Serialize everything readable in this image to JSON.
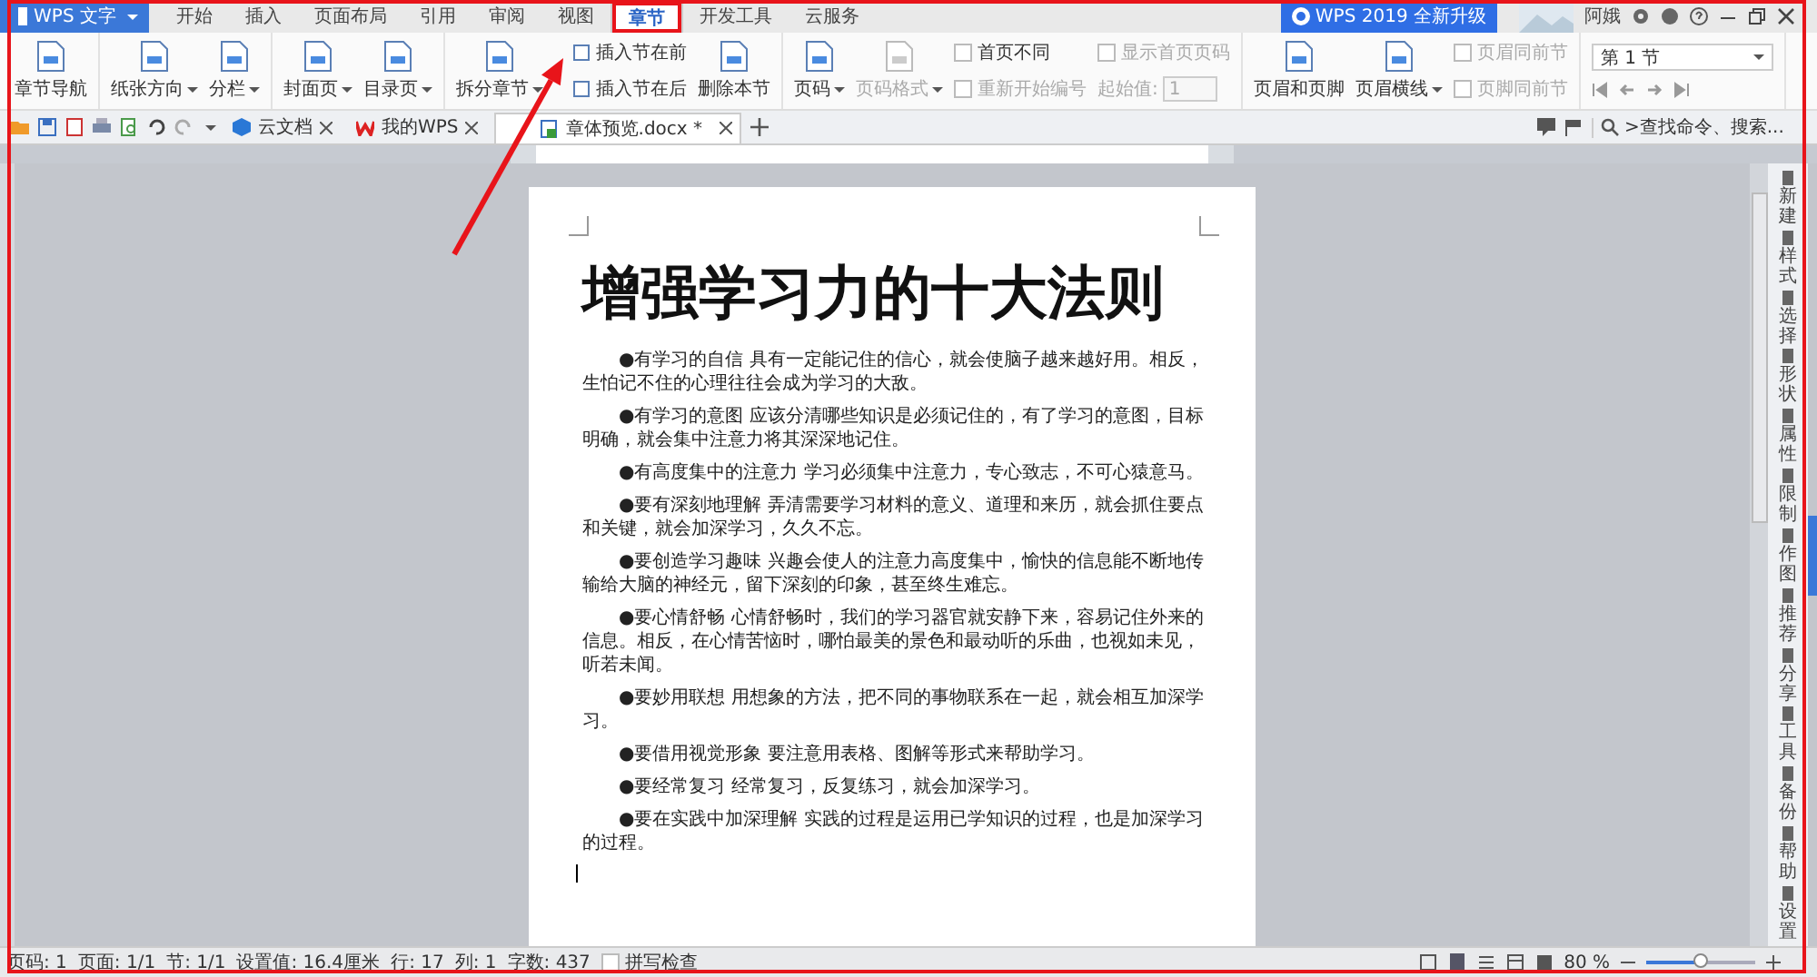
{
  "app_menu": {
    "label": "WPS 文字"
  },
  "menu_tabs": [
    {
      "label": "开始",
      "selected": false
    },
    {
      "label": "插入",
      "selected": false
    },
    {
      "label": "页面布局",
      "selected": false
    },
    {
      "label": "引用",
      "selected": false
    },
    {
      "label": "审阅",
      "selected": false
    },
    {
      "label": "视图",
      "selected": false
    },
    {
      "label": "章节",
      "selected": true
    },
    {
      "label": "开发工具",
      "selected": false
    },
    {
      "label": "云服务",
      "selected": false
    }
  ],
  "upgrade_button": "WPS 2019 全新升级",
  "user_name": "阿娥",
  "ribbon": [
    [
      [
        {
          "kind": "large",
          "label": "章节导航",
          "dropdown": false,
          "disabled": false
        }
      ]
    ],
    [
      [
        {
          "kind": "large",
          "label": "纸张方向",
          "dropdown": true,
          "disabled": false
        }
      ],
      [
        {
          "kind": "large",
          "label": "分栏",
          "dropdown": true,
          "disabled": false
        }
      ]
    ],
    [
      [
        {
          "kind": "large",
          "label": "封面页",
          "dropdown": true,
          "disabled": false
        }
      ],
      [
        {
          "kind": "large",
          "label": "目录页",
          "dropdown": true,
          "disabled": false
        }
      ]
    ],
    [
      [
        {
          "kind": "large",
          "label": "拆分章节",
          "dropdown": true,
          "disabled": false
        }
      ],
      [
        {
          "kind": "small",
          "label": "插入节在前",
          "disabled": false
        },
        {
          "kind": "small",
          "label": "插入节在后",
          "disabled": false
        }
      ],
      [
        {
          "kind": "large",
          "label": "删除本节",
          "dropdown": false,
          "disabled": false
        }
      ]
    ],
    [
      [
        {
          "kind": "large",
          "label": "页码",
          "dropdown": true,
          "disabled": false
        }
      ],
      [
        {
          "kind": "large",
          "label": "页码格式",
          "dropdown": true,
          "disabled": true
        }
      ],
      [
        {
          "kind": "check",
          "label": "首页不同",
          "checked": false,
          "disabled": false
        },
        {
          "kind": "check",
          "label": "重新开始编号",
          "checked": false,
          "disabled": true
        }
      ],
      [
        {
          "kind": "check",
          "label": "显示首页页码",
          "checked": false,
          "disabled": true
        },
        {
          "kind": "field",
          "label": "起始值:",
          "value": "1",
          "disabled": true
        }
      ]
    ],
    [
      [
        {
          "kind": "large",
          "label": "页眉和页脚",
          "dropdown": false,
          "disabled": false
        }
      ],
      [
        {
          "kind": "large",
          "label": "页眉横线",
          "dropdown": true,
          "disabled": false
        }
      ],
      [
        {
          "kind": "check",
          "label": "页眉同前节",
          "checked": false,
          "disabled": true
        },
        {
          "kind": "check",
          "label": "页脚同前节",
          "checked": false,
          "disabled": true
        }
      ]
    ],
    [
      [
        {
          "kind": "select",
          "value": "第 1 节"
        },
        {
          "kind": "nav"
        }
      ]
    ]
  ],
  "doc_tabs": [
    {
      "kind": "cloud",
      "label": "云文档",
      "selected": false
    },
    {
      "kind": "wps",
      "label": "我的WPS",
      "selected": false
    },
    {
      "kind": "doc",
      "label": "章体预览.docx *",
      "selected": true
    }
  ],
  "search": {
    "placeholder": ">查找命令、搜索..."
  },
  "document": {
    "title": "增强学习力的十大法则",
    "paragraphs": [
      "●有学习的自信 具有一定能记住的信心，就会使脑子越来越好用。相反，生怕记不住的心理往往会成为学习的大敌。",
      "●有学习的意图 应该分清哪些知识是必须记住的，有了学习的意图，目标明确，就会集中注意力将其深深地记住。",
      "●有高度集中的注意力 学习必须集中注意力，专心致志，不可心猿意马。",
      "●要有深刻地理解 弄清需要学习材料的意义、道理和来历，就会抓住要点和关键，就会加深学习，久久不忘。",
      "●要创造学习趣味 兴趣会使人的注意力高度集中，愉快的信息能不断地传输给大脑的神经元，留下深刻的印象，甚至终生难忘。",
      "●要心情舒畅 心情舒畅时，我们的学习器官就安静下来，容易记住外来的信息。相反，在心情苦恼时，哪怕最美的景色和最动听的乐曲，也视如未见，听若未闻。",
      "●要妙用联想 用想象的方法，把不同的事物联系在一起，就会相互加深学习。",
      "●要借用视觉形象 要注意用表格、图解等形式来帮助学习。",
      "●要经常复习 经常复习，反复练习，就会加深学习。",
      "●要在实践中加深理解 实践的过程是运用已学知识的过程，也是加深学习的过程。"
    ]
  },
  "side_panel": [
    "新建",
    "样式",
    "选择",
    "形状",
    "属性",
    "限制",
    "作图",
    "推荐",
    "分享",
    "工具",
    "备份",
    "帮助",
    "设置"
  ],
  "status_bar": {
    "items": [
      "页码: 1",
      "页面: 1/1",
      "节: 1/1",
      "设置值: 16.4厘米",
      "行: 17",
      "列: 1",
      "字数: 437"
    ],
    "spell_check": {
      "label": "拼写检查",
      "checked": false
    },
    "zoom": "80 %",
    "zoom_level": {
      "level": 0.5
    }
  }
}
